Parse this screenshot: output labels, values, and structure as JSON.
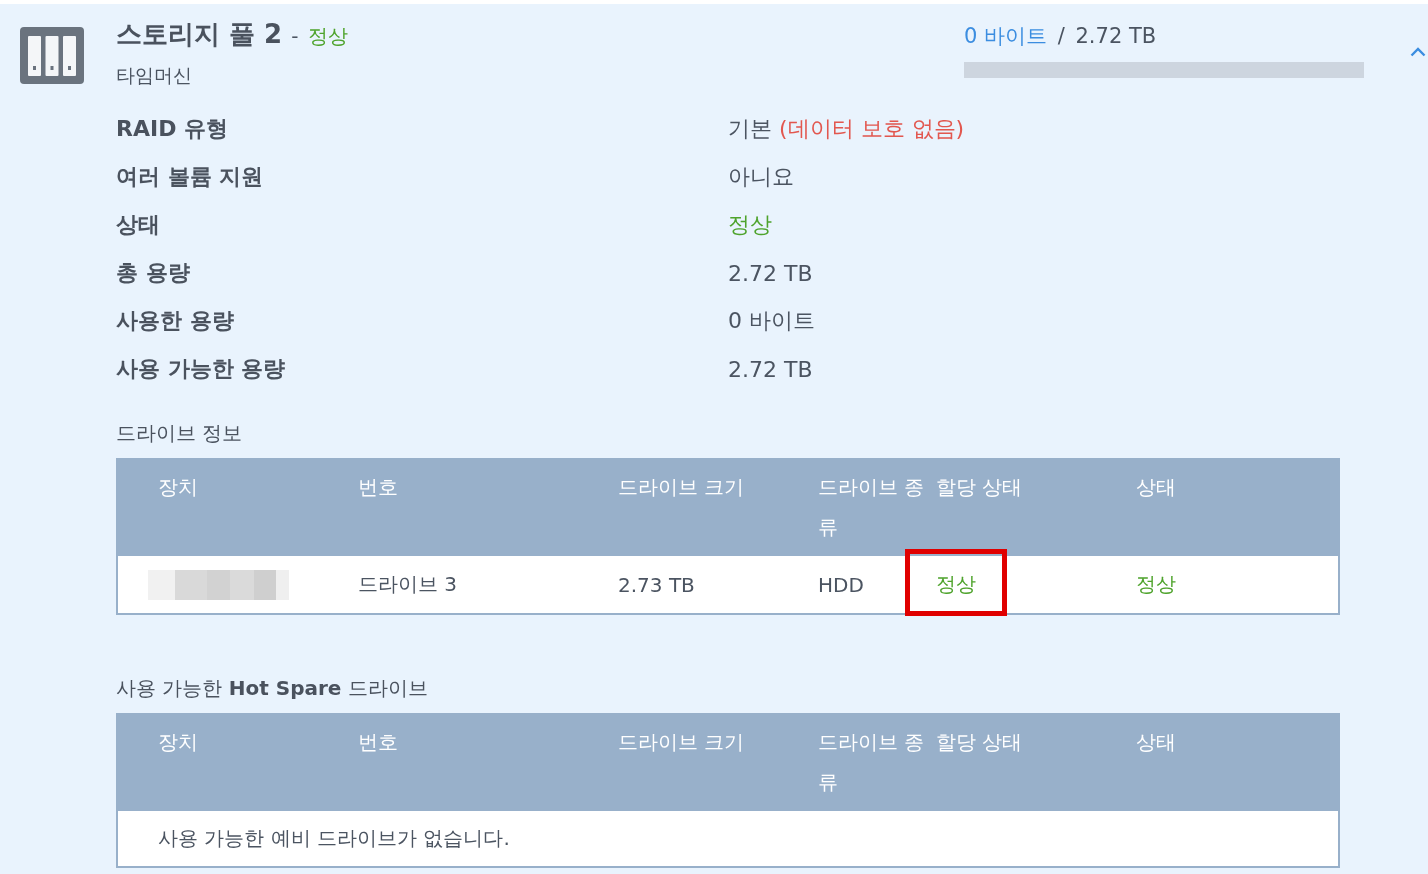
{
  "pool": {
    "title": "스토리지 풀 2",
    "separator": "-",
    "status": {
      "text": "정상",
      "color": "#4ea32c"
    },
    "subtitle": "타임머신",
    "expanded": true
  },
  "usage": {
    "used": "0 바이트",
    "separator": "/",
    "total": "2.72 TB",
    "level": 0
  },
  "properties": [
    {
      "label": "RAID 유형",
      "parts": [
        {
          "text": "기본",
          "color": "#4b5461"
        },
        {
          "text": "(데이터 보호 없음)",
          "color": "#e2574f"
        }
      ]
    },
    {
      "label": "여러 볼륨 지원",
      "parts": [
        {
          "text": "아니요",
          "color": "#4b5461"
        }
      ]
    },
    {
      "label": "상태",
      "parts": [
        {
          "text": "정상",
          "color": "#4ea32c"
        }
      ]
    },
    {
      "label": "총 용량",
      "parts": [
        {
          "text": "2.72 TB",
          "color": "#4b5461"
        }
      ]
    },
    {
      "label": "사용한 용량",
      "parts": [
        {
          "text": "0 바이트",
          "color": "#4b5461"
        }
      ]
    },
    {
      "label": "사용 가능한 용량",
      "parts": [
        {
          "text": "2.72 TB",
          "color": "#4b5461"
        }
      ]
    }
  ],
  "drive_info": {
    "title": "드라이브 정보",
    "columns": [
      "장치",
      "번호",
      "드라이브 크기",
      "드라이브 종류",
      "할당 상태",
      "상태"
    ],
    "rows": [
      {
        "cells": [
          {
            "kind": "redacted",
            "highlighted": false
          },
          {
            "kind": "text",
            "text": "드라이브 3",
            "color": "#4b5461",
            "highlighted": false
          },
          {
            "kind": "text",
            "text": "2.73 TB",
            "color": "#4b5461",
            "highlighted": false
          },
          {
            "kind": "text",
            "text": "HDD",
            "color": "#4b5461",
            "highlighted": false
          },
          {
            "kind": "text",
            "text": "정상",
            "color": "#4ea32c",
            "highlighted": true
          },
          {
            "kind": "text",
            "text": "정상",
            "color": "#4ea32c",
            "highlighted": false
          }
        ]
      }
    ]
  },
  "hot_spare": {
    "title": "사용 가능한 **Hot Spare** 드라이브",
    "columns": [
      "장치",
      "번호",
      "드라이브 크기",
      "드라이브 종류",
      "할당 상태",
      "상태"
    ],
    "empty_message": "사용 가능한 예비 드라이브가 없습니다."
  }
}
